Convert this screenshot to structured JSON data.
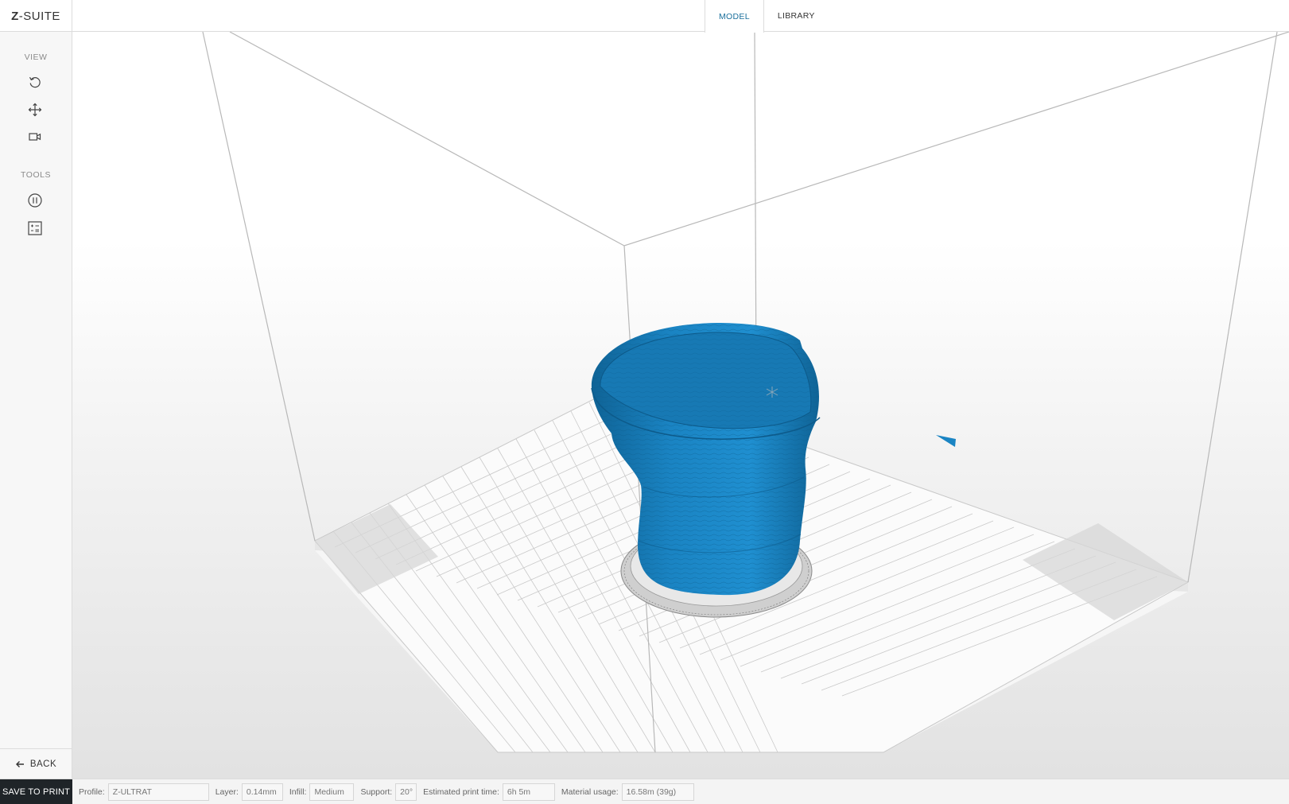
{
  "app": {
    "logo_prefix": "Z",
    "logo_suffix": "-SUITE"
  },
  "tabs": [
    {
      "label": "MODEL",
      "active": true
    },
    {
      "label": "LIBRARY",
      "active": false
    }
  ],
  "sidebar": {
    "view_label": "VIEW",
    "tools_label": "TOOLS",
    "view_tools": [
      "rotate-icon",
      "pan-icon",
      "camera-icon"
    ],
    "tools": [
      "pause-icon",
      "checklist-icon"
    ],
    "back_label": "BACK"
  },
  "bottom": {
    "save_label": "SAVE TO PRINT",
    "profile_label": "Profile:",
    "profile_value": "Z-ULTRAT",
    "layer_label": "Layer:",
    "layer_value": "0.14mm",
    "infill_label": "Infill:",
    "infill_value": "Medium",
    "support_label": "Support:",
    "support_value": "20°",
    "time_label": "Estimated print time:",
    "time_value": "6h 5m",
    "material_label": "Material usage:",
    "material_value": "16.58m (39g)"
  },
  "colors": {
    "model": "#1a84c3",
    "model_dark": "#0f6396",
    "accent": "#1a6f9c",
    "save_bg": "#1f2428"
  }
}
